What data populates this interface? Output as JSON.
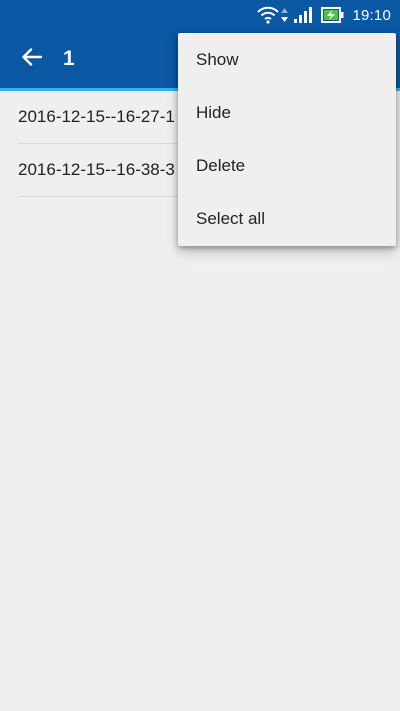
{
  "status_bar": {
    "time": "19:10",
    "icons": [
      "wifi-icon",
      "data-arrows-icon",
      "signal-icon",
      "battery-charging-icon"
    ],
    "color": "#0a57a4"
  },
  "app_bar": {
    "back_icon": "arrow-back-icon",
    "title": "1",
    "color": "#0a57a4",
    "accent_line": "#2bb7ea"
  },
  "list": {
    "items": [
      {
        "label": "2016-12-15--16-27-1"
      },
      {
        "label": "2016-12-15--16-38-3"
      }
    ]
  },
  "menu": {
    "items": [
      {
        "label": "Show"
      },
      {
        "label": "Hide"
      },
      {
        "label": "Delete"
      },
      {
        "label": "Select all"
      }
    ]
  }
}
